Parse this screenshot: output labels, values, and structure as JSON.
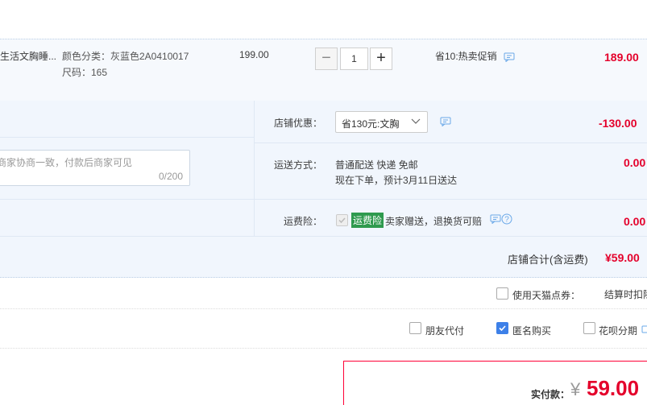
{
  "item": {
    "title": "生活文胸睡...",
    "sku_color": "颜色分类：灰蓝色2A0410017",
    "sku_size": "尺码：165",
    "unit_price": "199.00",
    "quantity": "1",
    "promo": "省10:热卖促销",
    "subtotal": "189.00"
  },
  "order": {
    "message_placeholder": "商家协商一致，付款后商家可见",
    "message_counter": "0/200",
    "shop_discount_label": "店铺优惠：",
    "shop_discount_value": "省130元:文胸",
    "shop_discount_amount": "-130.00",
    "shipping_label": "运送方式：",
    "shipping_method": "普通配送 快递 免邮",
    "shipping_eta": "现在下单，预计3月11日送达",
    "shipping_amount": "0.00",
    "insurance_label": "运费险：",
    "insurance_tag": "运费险",
    "insurance_desc": "卖家赠送，退换货可赔",
    "insurance_amount": "0.00",
    "shop_total_label": "店铺合计(含运费)",
    "shop_total_value": "¥59.00"
  },
  "options": {
    "tmall_points": "使用天猫点券：",
    "settle_note": "结算时扣除",
    "friend_pay": "朋友代付",
    "anonymous": "匿名购买",
    "installment": "花呗分期"
  },
  "payment": {
    "label": "实付款：",
    "currency": "¥",
    "amount": "59.00"
  },
  "colors": {
    "price_red": "#e4002b",
    "accent_blue": "#3d80e8",
    "panel_bg": "#f1f6fd",
    "insurance_green": "#2f9a4e"
  }
}
